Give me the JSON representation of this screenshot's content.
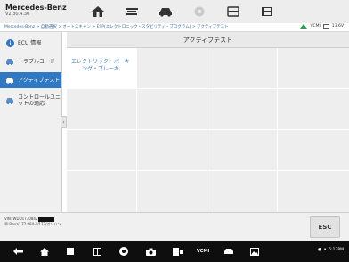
{
  "app": {
    "brand": "Mercedes-Benz",
    "version": "V2.30.4.30"
  },
  "toolbar": {
    "buttons": [
      "home-icon",
      "vehicle-menu-icon",
      "car-diag-icon",
      "settings-icon",
      "print-icon",
      "save-icon"
    ]
  },
  "breadcrumb": {
    "text": "Mercedes-Benz > 自動選択 > オートスキャン > ESP(エレクトロニック・スタビリティ・プログラム) > アクティブテスト"
  },
  "status": {
    "connection": "VCMI",
    "battery": "13.6V"
  },
  "sidebar": {
    "items": [
      {
        "label": "ECU 情報",
        "icon": "info-icon",
        "active": false
      },
      {
        "label": "トラブルコード",
        "icon": "trouble-code-icon",
        "active": false
      },
      {
        "label": "アクティブテスト",
        "icon": "active-test-icon",
        "active": true
      },
      {
        "label": "コントロールユニットの適応",
        "icon": "adaptation-icon",
        "active": false
      }
    ]
  },
  "main": {
    "title": "アクティブテスト",
    "tests": [
      "エレクトリック・パーキング・ブレーキ"
    ]
  },
  "footer": {
    "vin_label": "VIN: WDD1770842",
    "vehicle_line": "車:Benz/177.084-4/177/ガソリン",
    "esc_label": "ESC"
  },
  "navbar": {
    "items": [
      "back-icon",
      "home-icon",
      "recent-apps-icon",
      "app-drawer-icon",
      "chrome-icon",
      "camera-icon",
      "screen-record-icon",
      "vcmi-icon",
      "car-icon",
      "gallery-icon"
    ],
    "vcmi_label": "VCMI",
    "status_text": "5:17PM"
  },
  "colors": {
    "accent": "#2e78c4",
    "toolbar_bg": "#ededed",
    "nav_bg": "#0e0e0e"
  }
}
